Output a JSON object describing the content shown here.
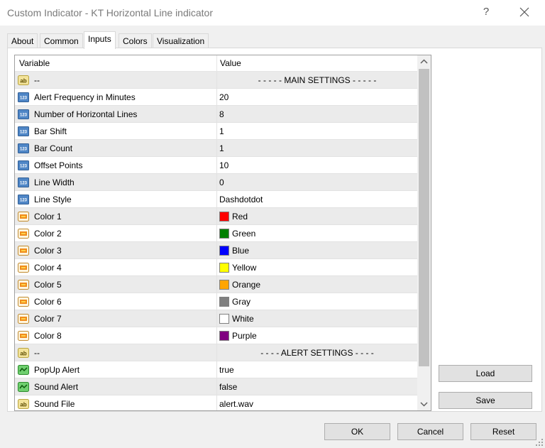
{
  "window": {
    "title": "Custom Indicator - KT Horizontal Line indicator",
    "help_label": "?"
  },
  "tabs": [
    {
      "label": "About"
    },
    {
      "label": "Common"
    },
    {
      "label": "Inputs"
    },
    {
      "label": "Colors"
    },
    {
      "label": "Visualization"
    }
  ],
  "table": {
    "columns": {
      "variable": "Variable",
      "value": "Value"
    },
    "rows": [
      {
        "icon": "ab-string-icon",
        "variable": "--",
        "value": "- - - - - MAIN SETTINGS - - - - -"
      },
      {
        "icon": "123-integer-icon",
        "variable": "Alert Frequency in Minutes",
        "value": "20"
      },
      {
        "icon": "123-integer-icon",
        "variable": "Number of Horizontal Lines",
        "value": "8"
      },
      {
        "icon": "123-integer-icon",
        "variable": "Bar Shift",
        "value": "1"
      },
      {
        "icon": "123-integer-icon",
        "variable": "Bar Count",
        "value": "1"
      },
      {
        "icon": "123-integer-icon",
        "variable": "Offset Points",
        "value": "10"
      },
      {
        "icon": "123-integer-icon",
        "variable": "Line Width",
        "value": "0"
      },
      {
        "icon": "123-integer-icon",
        "variable": "Line Style",
        "value": "Dashdotdot"
      },
      {
        "icon": "color-palette-icon",
        "variable": "Color 1",
        "value": "Red",
        "swatch": "#ff0000"
      },
      {
        "icon": "color-palette-icon",
        "variable": "Color 2",
        "value": "Green",
        "swatch": "#008000"
      },
      {
        "icon": "color-palette-icon",
        "variable": "Color 3",
        "value": "Blue",
        "swatch": "#0000ff"
      },
      {
        "icon": "color-palette-icon",
        "variable": "Color 4",
        "value": "Yellow",
        "swatch": "#ffff00"
      },
      {
        "icon": "color-palette-icon",
        "variable": "Color 5",
        "value": "Orange",
        "swatch": "#ffa500"
      },
      {
        "icon": "color-palette-icon",
        "variable": "Color 6",
        "value": "Gray",
        "swatch": "#808080"
      },
      {
        "icon": "color-palette-icon",
        "variable": "Color 7",
        "value": "White",
        "swatch": "#ffffff"
      },
      {
        "icon": "color-palette-icon",
        "variable": "Color 8",
        "value": "Purple",
        "swatch": "#800080"
      },
      {
        "icon": "ab-string-icon",
        "variable": "--",
        "value": "- - - - ALERT SETTINGS - - - -"
      },
      {
        "icon": "bool-toggle-icon",
        "variable": "PopUp Alert",
        "value": "true"
      },
      {
        "icon": "bool-toggle-icon",
        "variable": "Sound Alert",
        "value": "false"
      },
      {
        "icon": "ab-string-icon",
        "variable": "Sound File",
        "value": "alert.wav"
      }
    ]
  },
  "buttons": {
    "load": "Load",
    "save": "Save",
    "ok": "OK",
    "cancel": "Cancel",
    "reset": "Reset"
  }
}
